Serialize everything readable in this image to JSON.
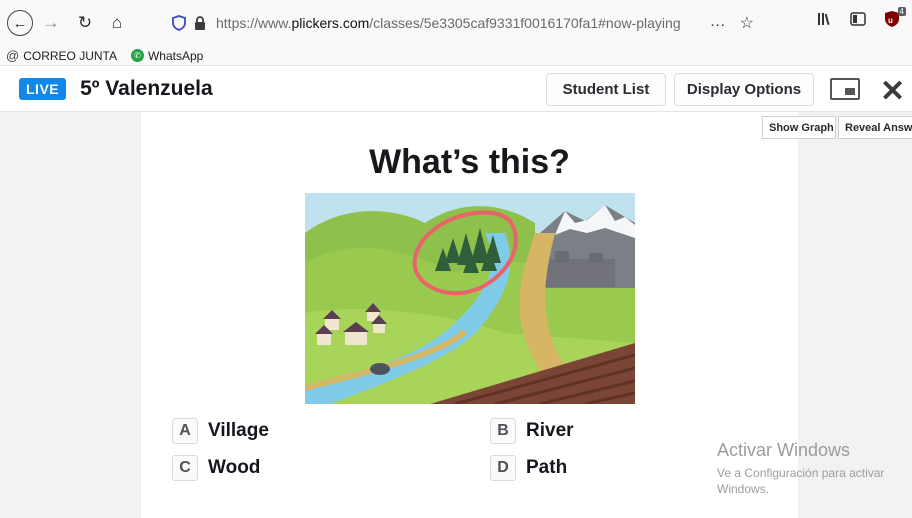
{
  "browser": {
    "url_prefix": "https://www.",
    "url_domain": "plickers.com",
    "url_path": "/classes/5e3305caf9331f0016170fa1#now-playing",
    "more_glyph": "…",
    "star_glyph": "☆",
    "back_glyph": "←",
    "forward_glyph": "→",
    "reload_glyph": "↻",
    "home_glyph": "⌂",
    "ublock_badge": "4"
  },
  "bookmarks": [
    {
      "label": "CORREO JUNTA",
      "icon": "at-icon"
    },
    {
      "label": "WhatsApp",
      "icon": "whatsapp-icon"
    }
  ],
  "header": {
    "live_label": "LIVE",
    "class_name": "5º Valenzuela",
    "student_list_label": "Student List",
    "display_options_label": "Display Options",
    "close_glyph": "✕"
  },
  "slide_controls": {
    "show_graph_label": "Show Graph",
    "reveal_answer_label": "Reveal Answe"
  },
  "question": {
    "text": "What’s this?",
    "choices": [
      {
        "letter": "A",
        "text": "Village"
      },
      {
        "letter": "B",
        "text": "River"
      },
      {
        "letter": "C",
        "text": "Wood"
      },
      {
        "letter": "D",
        "text": "Path"
      }
    ]
  },
  "watermark": {
    "title": "Activar Windows",
    "line1": "Ve a Configuración para activar",
    "line2": "Windows."
  },
  "colors": {
    "live_badge": "#0f88e9",
    "highlight_circle": "#e9646a"
  }
}
